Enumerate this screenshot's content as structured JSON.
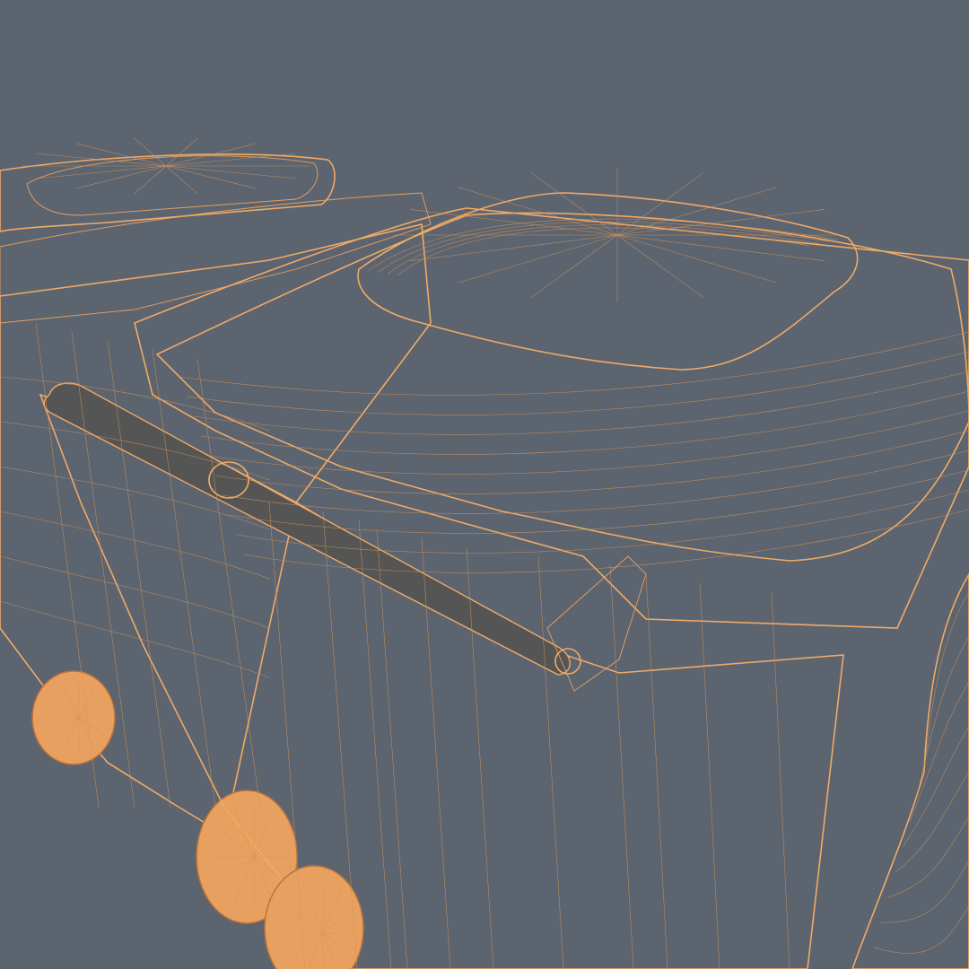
{
  "scene": {
    "background_color": "#5c6470",
    "mesh_fill_color": "#2f2f2f",
    "wire_color": "#e8a060",
    "subject": "wheelie-bins-wireframe"
  }
}
